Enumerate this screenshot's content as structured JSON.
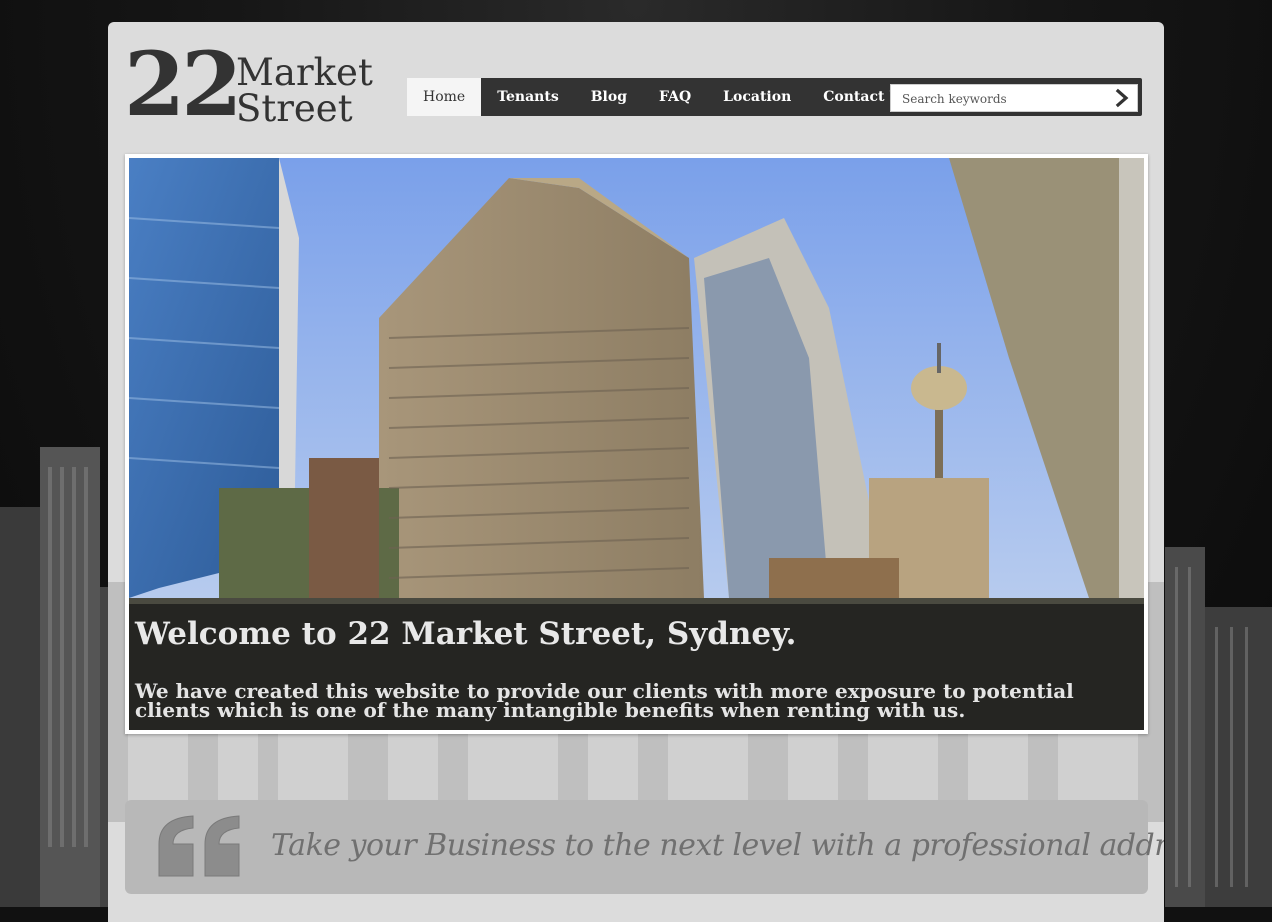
{
  "logo": {
    "number": "22",
    "line1": "Market",
    "line2": "Street"
  },
  "nav": {
    "items": [
      {
        "label": "Home",
        "active": true
      },
      {
        "label": "Tenants"
      },
      {
        "label": "Blog"
      },
      {
        "label": "FAQ"
      },
      {
        "label": "Location"
      },
      {
        "label": "Contact Us"
      }
    ]
  },
  "search": {
    "placeholder": "Search keywords",
    "button_icon": "chevron-right-icon"
  },
  "hero": {
    "title": "Welcome to 22 Market Street, Sydney.",
    "text": "We have created this website to provide our clients with more exposure to potential clients which is one of the many intangible benefits when renting with us."
  },
  "quote": {
    "icon": "quote-mark-icon",
    "text": "Take your Business to the next level with a professional address."
  },
  "colors": {
    "navbar": "#333333",
    "page_bg": "#dcdcdc",
    "quote_bg": "#b8b8b8",
    "sky": "#7fa6ee"
  }
}
